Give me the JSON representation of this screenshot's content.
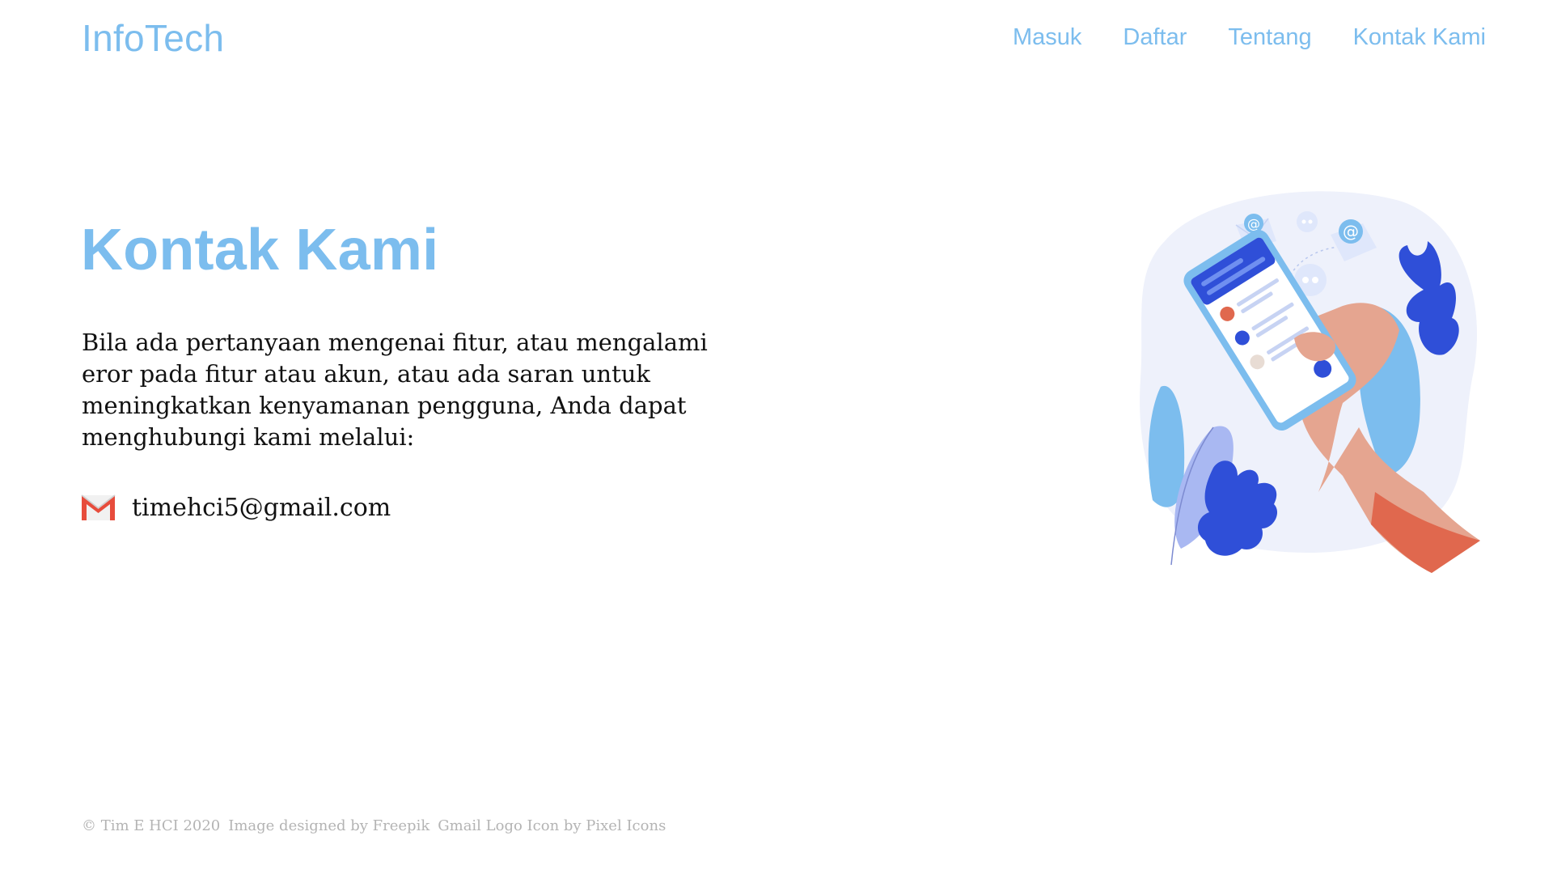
{
  "header": {
    "logo": "InfoTech",
    "nav": [
      "Masuk",
      "Daftar",
      "Tentang",
      "Kontak Kami"
    ]
  },
  "main": {
    "title": "Kontak Kami",
    "description": "Bila ada pertanyaan mengenai fitur, atau mengalami eror pada fitur atau akun, atau ada saran untuk meningkatkan kenyamanan pengguna, Anda dapat menghubungi kami melalui:",
    "email": "timehci5@gmail.com",
    "email_icon": "gmail-icon",
    "illustration_icon": "contact-illustration"
  },
  "footer": {
    "copyright": "© Tim E HCI 2020",
    "image_credit": "Image designed by Freepik",
    "icon_credit": "Gmail Logo Icon by Pixel Icons"
  },
  "colors": {
    "accent": "#7cbdee",
    "text": "#111111",
    "muted": "#b4b4b4"
  }
}
